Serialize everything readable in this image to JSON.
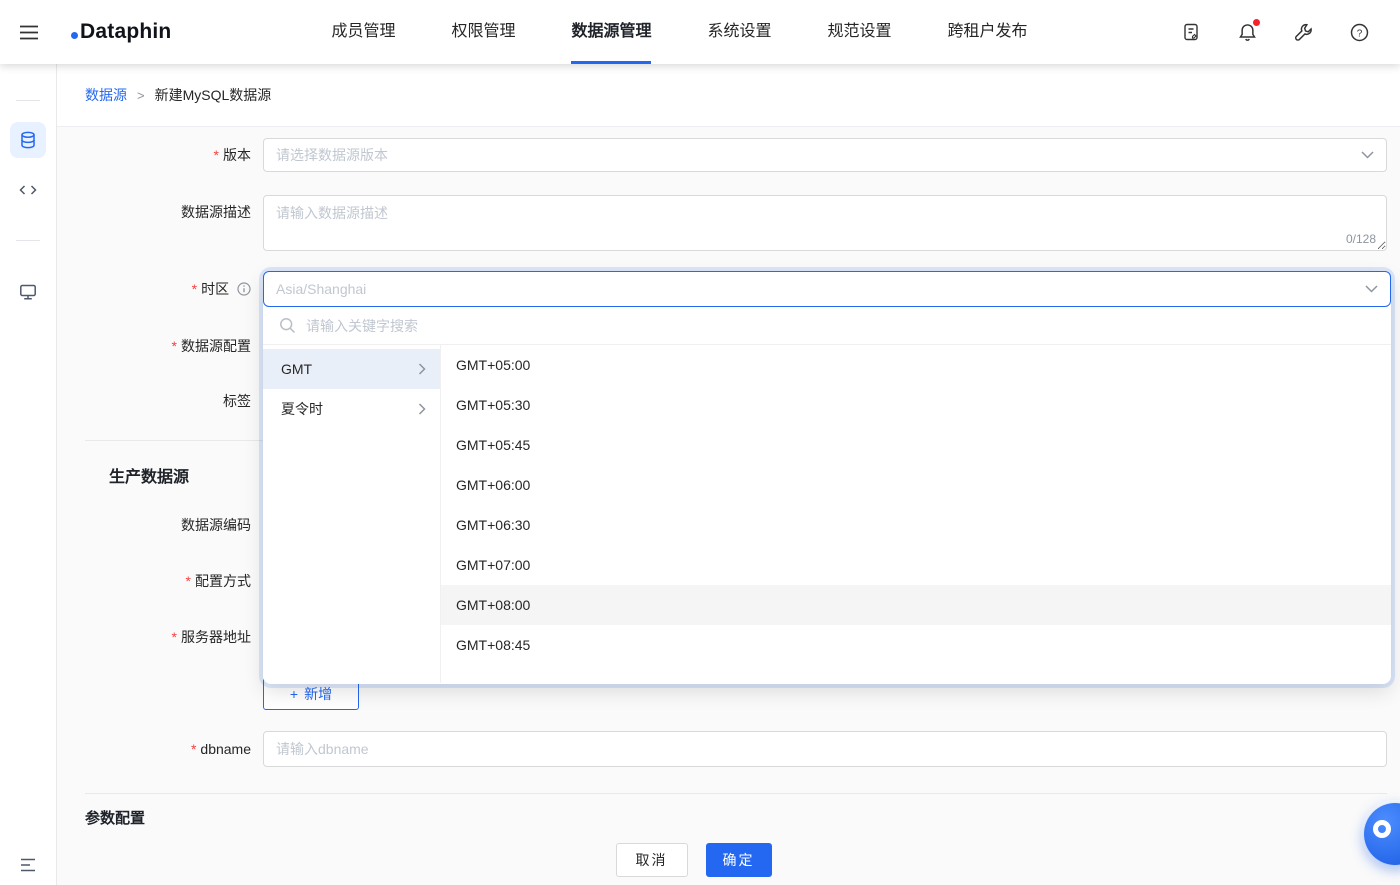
{
  "brand": {
    "logo": "Dataphin"
  },
  "navbar": {
    "items": [
      {
        "label": "成员管理"
      },
      {
        "label": "权限管理"
      },
      {
        "label": "数据源管理"
      },
      {
        "label": "系统设置"
      },
      {
        "label": "规范设置"
      },
      {
        "label": "跨租户发布"
      }
    ]
  },
  "breadcrumb": {
    "parent": "数据源",
    "separator": ">",
    "current": "新建MySQL数据源"
  },
  "form": {
    "required_mark": "*",
    "version_label": "版本",
    "version_placeholder": "请选择数据源版本",
    "description_label": "数据源描述",
    "description_placeholder": "请输入数据源描述",
    "description_counter": "0/128",
    "timezone_label": "时区",
    "timezone_value": "Asia/Shanghai",
    "datasource_config_label": "数据源配置",
    "tag_label": "标签",
    "production_section_title": "生产数据源",
    "datasource_code_label": "数据源编码",
    "config_mode_label": "配置方式",
    "server_address_label": "服务器地址",
    "add_plus": "+",
    "add_button_label": "新增",
    "dbname_label": "dbname",
    "dbname_placeholder": "请输入dbname",
    "params_section_title": "参数配置"
  },
  "timezone_dropdown": {
    "search_placeholder": "请输入关键字搜索",
    "groups": [
      {
        "label": "GMT"
      },
      {
        "label": "夏令时"
      }
    ],
    "options": [
      {
        "label": "GMT+05:00"
      },
      {
        "label": "GMT+05:30"
      },
      {
        "label": "GMT+05:45"
      },
      {
        "label": "GMT+06:00"
      },
      {
        "label": "GMT+06:30"
      },
      {
        "label": "GMT+07:00"
      },
      {
        "label": "GMT+08:00"
      },
      {
        "label": "GMT+08:45"
      }
    ]
  },
  "footer": {
    "cancel_label": "取消",
    "confirm_label": "确定"
  },
  "colors": {
    "primary": "#2468f2",
    "link": "#2468f2",
    "danger": "#f53f3f",
    "notification_badge": "#f5222d"
  }
}
